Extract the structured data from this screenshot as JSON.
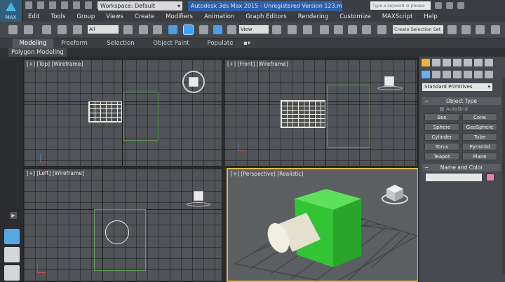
{
  "app": {
    "button_label": "MAX",
    "workspace": "Workspace: Default",
    "window_title": "Autodesk 3ds Max  2015  - Unregistered Version     123.max",
    "search_placeholder": "Type a keyword or phrase"
  },
  "menu": [
    "Edit",
    "Tools",
    "Group",
    "Views",
    "Create",
    "Modifiers",
    "Animation",
    "Graph Editors",
    "Rendering",
    "Customize",
    "MAXScript",
    "Help"
  ],
  "toolbar": {
    "selection_filter": "All",
    "reference_coord": "View",
    "named_selection_set": "Create Selection Set"
  },
  "ribbon": {
    "tabs": [
      "Modeling",
      "Freeform",
      "Selection",
      "Object Paint",
      "Populate"
    ],
    "active_tab": "Modeling",
    "sub_label": "Polygon Modeling"
  },
  "viewports": {
    "top": "[+] [Top] [Wireframe]",
    "front": "[+] [Front] [Wireframe]",
    "left": "[+] [Left] [Wireframe]",
    "perspective": "[+] [Perspective] [Realistic]"
  },
  "command_panel": {
    "category": "Standard Primitives",
    "object_type_title": "Object Type",
    "autogrid_label": "AutoGrid",
    "buttons": [
      "Box",
      "Cone",
      "Sphere",
      "GeoSphere",
      "Cylinder",
      "Tube",
      "Torus",
      "Pyramid",
      "Teapot",
      "Plane"
    ],
    "name_color_title": "Name and Color",
    "object_color": "#e77fae"
  },
  "colors": {
    "box_green": "#37c43a",
    "cylinder_cream": "#ece8d8",
    "active_viewport_border": "#e0b84a"
  }
}
